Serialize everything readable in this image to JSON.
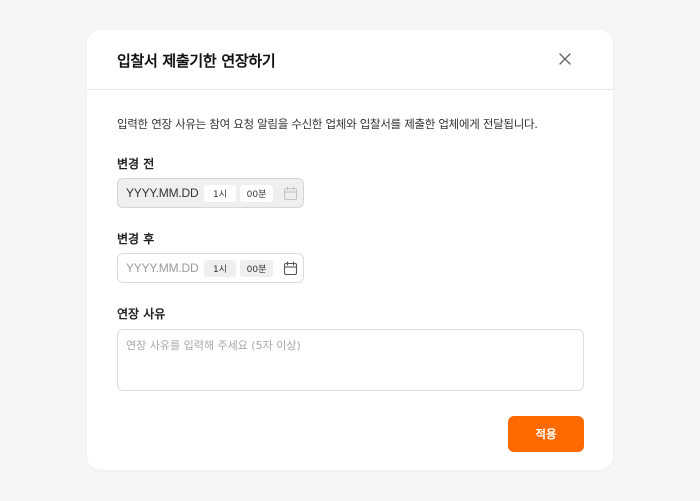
{
  "modal": {
    "title": "입찰서 제출기한 연장하기",
    "description": "입력한 연장 사유는 참여 요청 알림을 수신한 업체와 입찰서를 제출한 업체에게 전달됩니다."
  },
  "before": {
    "label": "변경 전",
    "date": "YYYY.MM.DD",
    "hour": "1시",
    "minute": "00분",
    "disabled": true
  },
  "after": {
    "label": "변경 후",
    "date_placeholder": "YYYY.MM.DD",
    "hour": "1시",
    "minute": "00분"
  },
  "reason": {
    "label": "연장 사유",
    "placeholder": "연장 사유를 입력해 주세요 (5자 이상)"
  },
  "actions": {
    "apply_label": "적용"
  },
  "colors": {
    "accent": "#ff6a00",
    "background": "#f6f6f6",
    "disabled_field": "#efefef"
  },
  "icons": [
    "close-icon",
    "calendar-icon"
  ]
}
